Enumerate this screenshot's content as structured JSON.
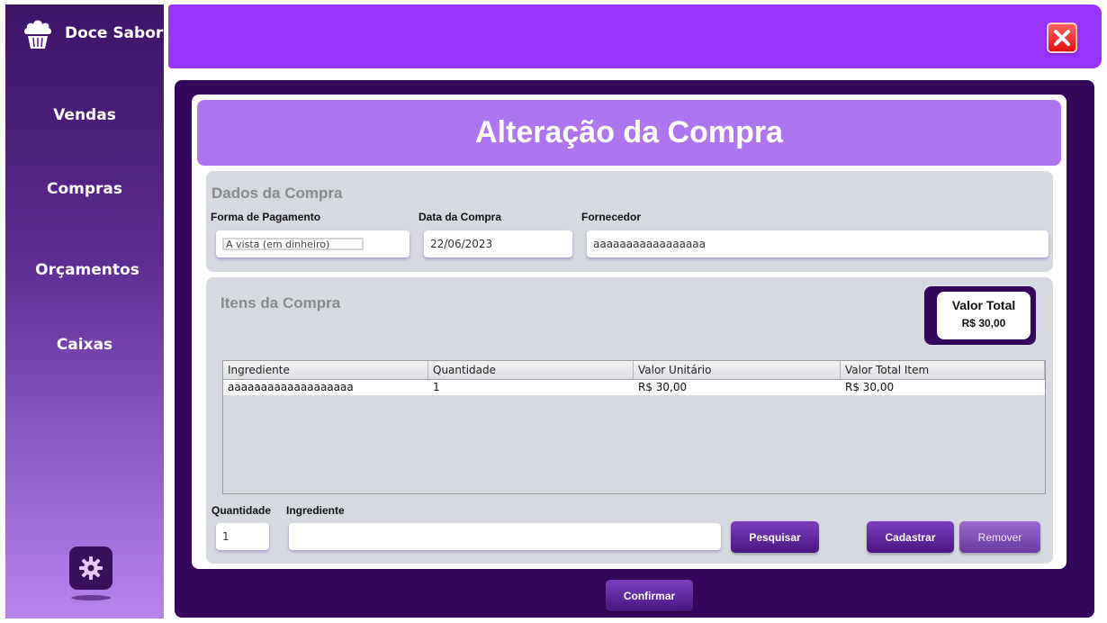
{
  "brand": {
    "name": "Doce Sabor",
    "logo_icon": "cupcake-icon"
  },
  "sidebar": {
    "items": [
      {
        "label": "Vendas"
      },
      {
        "label": "Compras"
      },
      {
        "label": "Orçamentos"
      },
      {
        "label": "Caixas"
      }
    ],
    "settings_icon": "gear-icon"
  },
  "topbar": {
    "close_icon": "close-icon"
  },
  "page": {
    "title": "Alteração da Compra"
  },
  "dados": {
    "title": "Dados da Compra",
    "forma_pagamento_label": "Forma de Pagamento",
    "forma_pagamento_value": "A vista (em dinheiro)",
    "data_label": "Data da Compra",
    "data_value": "22/06/2023",
    "fornecedor_label": "Fornecedor",
    "fornecedor_value": "aaaaaaaaaaaaaaaaa"
  },
  "itens": {
    "title": "Itens da Compra",
    "total_label": "Valor Total",
    "total_value": "R$ 30,00",
    "table": {
      "headers": [
        "Ingrediente",
        "Quantidade",
        "Valor Unitário",
        "Valor Total Item"
      ],
      "rows": [
        [
          "aaaaaaaaaaaaaaaaaaa",
          "1",
          "R$ 30,00",
          "R$ 30,00"
        ]
      ]
    },
    "quantidade_label": "Quantidade",
    "quantidade_value": "1",
    "ingrediente_label": "Ingrediente",
    "ingrediente_value": "",
    "pesquisar_label": "Pesquisar",
    "cadastrar_label": "Cadastrar",
    "remover_label": "Remover"
  },
  "confirm_label": "Confirmar",
  "colors": {
    "accent": "#9933ff",
    "dark": "#34075a",
    "header": "#ad75f0",
    "section": "#d6d9e0"
  }
}
